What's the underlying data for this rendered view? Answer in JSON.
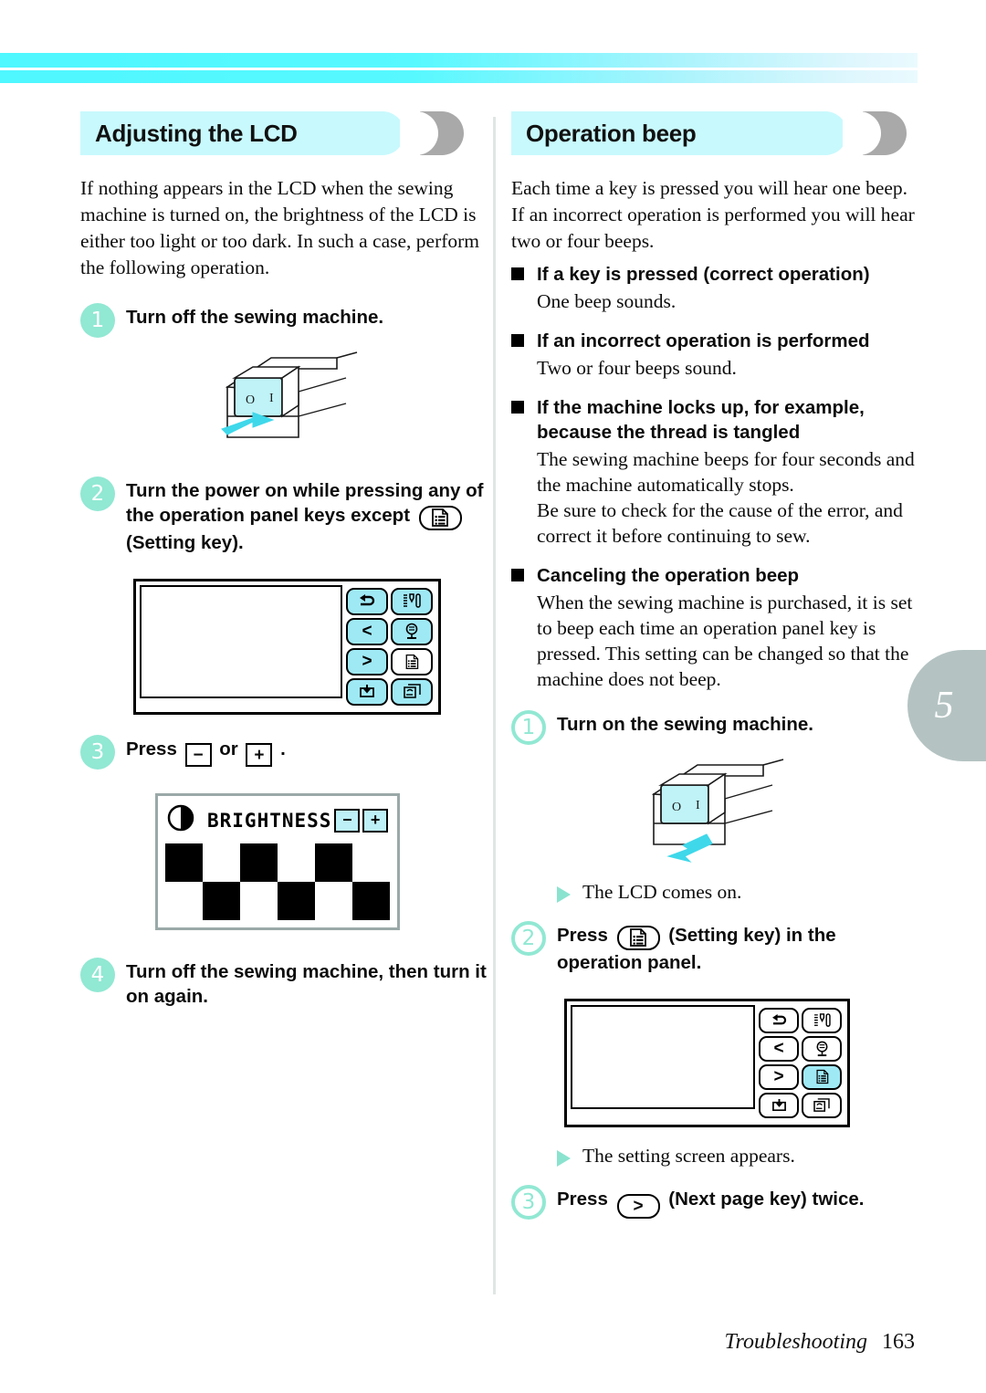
{
  "page": {
    "chapter_tab": "5",
    "footer_section": "Troubleshooting",
    "footer_page": "163",
    "accent_cyan": "#4ff7ff",
    "accent_mint": "#91e8d3",
    "heading_bg": "#c8f9fd",
    "tab_gray": "#b4c3c2"
  },
  "left": {
    "heading": "Adjusting the LCD",
    "intro": "If nothing appears in the LCD when the sewing machine is turned on, the brightness of the LCD is either too light or too dark. In such a case, perform the following operation.",
    "steps": [
      {
        "num": "1",
        "text_before": "Turn off the sewing machine.",
        "text_after": ""
      },
      {
        "num": "2",
        "text_before": "Turn the power on while pressing any of the operation panel keys except",
        "text_after": "(Setting key)."
      },
      {
        "num": "3",
        "text_before": "Press",
        "text_mid": "or",
        "text_after": "."
      },
      {
        "num": "4",
        "text_before": "Turn off the sewing machine, then turn it on again.",
        "text_after": ""
      }
    ],
    "switch_labels": {
      "off": "O",
      "on": "I"
    },
    "lcd": {
      "title": "BRIGHTNESS",
      "minus": "−",
      "plus": "+",
      "checker_rows": [
        [
          "b",
          "w",
          "b",
          "w",
          "b",
          "w"
        ],
        [
          "w",
          "b",
          "w",
          "b",
          "w",
          "b"
        ]
      ]
    },
    "minus_key": "−",
    "plus_key": "+"
  },
  "right": {
    "heading": "Operation beep",
    "intro": "Each time a key is pressed you will hear one beep. If an incorrect operation is performed you will hear two or four beeps.",
    "bullets": [
      {
        "title": "If a key is pressed (correct operation)",
        "body": "One beep sounds."
      },
      {
        "title": "If an incorrect operation is performed",
        "body": "Two or four beeps sound."
      },
      {
        "title": "If the machine locks up, for example, because the thread is tangled",
        "body": "The sewing machine beeps for four seconds and the machine automatically stops.\nBe sure to check for the cause of the error, and correct it before continuing to sew."
      },
      {
        "title": "Canceling the operation beep",
        "body": "When the sewing machine is purchased, it is set to beep each time an operation panel key is pressed. This setting can be changed so that the machine does not beep."
      }
    ],
    "steps": [
      {
        "num": "1",
        "text_before": "Turn on the sewing machine.",
        "text_after": ""
      },
      {
        "num": "2",
        "text_before": "Press",
        "text_after": "(Setting key) in the operation panel."
      },
      {
        "num": "3",
        "text_before": "Press",
        "text_after": "(Next page key) twice."
      }
    ],
    "results": [
      "The LCD comes on.",
      "The setting screen appears."
    ],
    "switch_labels": {
      "off": "O",
      "on": "I"
    }
  },
  "panel": {
    "keys_left": [
      "return-key",
      "previous-page-key",
      "next-page-key",
      "needle-position-key"
    ],
    "keys_right": [
      "thread-cutter-key",
      "presser-foot-key",
      "setting-key",
      "reverse-stitch-key"
    ],
    "setting_key_state_step2_left": "off",
    "setting_key_state_step2_right": "on"
  }
}
